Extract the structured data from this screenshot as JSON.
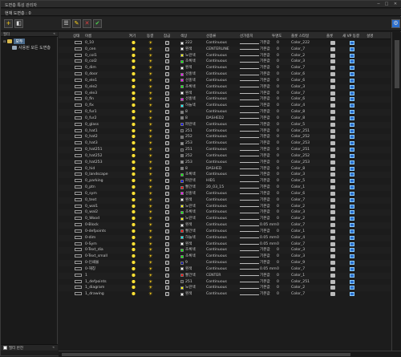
{
  "window": {
    "title": "도면층 특성 관리자",
    "controls": [
      "─",
      "□",
      "✕"
    ]
  },
  "current_layer": {
    "label": "현재 도면층 : 0"
  },
  "toolbar": {
    "new_filter": "+",
    "new_group": "◧",
    "layer_states": "☰",
    "new_layer": "✎",
    "delete_layer": "✕",
    "set_current": "✔",
    "settings": "⚙"
  },
  "left_panel": {
    "header": "필터",
    "collapse": "«",
    "root": "모두",
    "child": "사용된 모든 도면층",
    "invert_filter": "필터 반전",
    "collapse2": "«"
  },
  "columns": [
    "상태",
    "이름",
    "켜기",
    "동결",
    "잠금",
    "색상",
    "선종류",
    "선가중치",
    "투명도",
    "플롯 스타일",
    "플롯",
    "새 VP 동결",
    "설명"
  ],
  "rows": [
    {
      "name": "0_10",
      "color": "#ffffff",
      "color_name": "222",
      "linetype": "Continuous",
      "lw": "기본값",
      "tr": "0",
      "ps": "Color_222"
    },
    {
      "name": "0_cen",
      "color": "#ffffff",
      "color_name": "흰색",
      "linetype": "CENTERLINE",
      "lw": "기본값",
      "tr": "0",
      "ps": "Color_7"
    },
    {
      "name": "0_col1",
      "color": "#ffff00",
      "color_name": "노란색",
      "linetype": "Continuous",
      "lw": "기본값",
      "tr": "0",
      "ps": "Color_2"
    },
    {
      "name": "0_col2",
      "color": "#00ff00",
      "color_name": "초록색",
      "linetype": "Continuous",
      "lw": "기본값",
      "tr": "0",
      "ps": "Color_3"
    },
    {
      "name": "0_dim",
      "color": "#ffffff",
      "color_name": "흰색",
      "linetype": "Continuous",
      "lw": "기본값",
      "tr": "0",
      "ps": "Color_7"
    },
    {
      "name": "0_door",
      "color": "#ff00ff",
      "color_name": "선홍색",
      "linetype": "Continuous",
      "lw": "기본값",
      "tr": "0",
      "ps": "Color_6"
    },
    {
      "name": "0_ele1",
      "color": "#ff00ff",
      "color_name": "선홍색",
      "linetype": "Continuous",
      "lw": "기본값",
      "tr": "0",
      "ps": "Color_6"
    },
    {
      "name": "0_ele2",
      "color": "#00ff00",
      "color_name": "초록색",
      "linetype": "Continuous",
      "lw": "기본값",
      "tr": "0",
      "ps": "Color_3"
    },
    {
      "name": "0_ele3",
      "color": "#ffffff",
      "color_name": "흰색",
      "linetype": "Continuous",
      "lw": "기본값",
      "tr": "0",
      "ps": "Color_7"
    },
    {
      "name": "0_fin",
      "color": "#ff00ff",
      "color_name": "선홍색",
      "linetype": "Continuous",
      "lw": "기본값",
      "tr": "0",
      "ps": "Color_6"
    },
    {
      "name": "0_fix",
      "color": "#00ffff",
      "color_name": "하늘색",
      "linetype": "Continuous",
      "lw": "기본값",
      "tr": "0",
      "ps": "Color_4"
    },
    {
      "name": "0_fur1",
      "color": "#808080",
      "color_name": "8",
      "linetype": "Continuous",
      "lw": "기본값",
      "tr": "0",
      "ps": "Color_8"
    },
    {
      "name": "0_fur2",
      "color": "#808080",
      "color_name": "8",
      "linetype": "DASHED2",
      "lw": "기본값",
      "tr": "0",
      "ps": "Color_8"
    },
    {
      "name": "0_glass",
      "color": "#0000ff",
      "color_name": "파란색",
      "linetype": "Continuous",
      "lw": "기본값",
      "tr": "0",
      "ps": "Color_5"
    },
    {
      "name": "0_hat1",
      "color": "#3c3c3c",
      "color_name": "251",
      "linetype": "Continuous",
      "lw": "기본값",
      "tr": "0",
      "ps": "Color_251"
    },
    {
      "name": "0_hat2",
      "color": "#707070",
      "color_name": "252",
      "linetype": "Continuous",
      "lw": "기본값",
      "tr": "0",
      "ps": "Color_252"
    },
    {
      "name": "0_hat3",
      "color": "#989898",
      "color_name": "253",
      "linetype": "Continuous",
      "lw": "기본값",
      "tr": "0",
      "ps": "Color_253"
    },
    {
      "name": "0_hat251",
      "color": "#3c3c3c",
      "color_name": "251",
      "linetype": "Continuous",
      "lw": "기본값",
      "tr": "0",
      "ps": "Color_251"
    },
    {
      "name": "0_hat252",
      "color": "#707070",
      "color_name": "252",
      "linetype": "Continuous",
      "lw": "기본값",
      "tr": "0",
      "ps": "Color_252"
    },
    {
      "name": "0_hat253",
      "color": "#989898",
      "color_name": "253",
      "linetype": "Continuous",
      "lw": "기본값",
      "tr": "0",
      "ps": "Color_253"
    },
    {
      "name": "0_hid",
      "color": "#808080",
      "color_name": "8",
      "linetype": "DASHED",
      "lw": "기본값",
      "tr": "0",
      "ps": "Color_8"
    },
    {
      "name": "0_landscape",
      "color": "#00ff00",
      "color_name": "초록색",
      "linetype": "Continuous",
      "lw": "기본값",
      "tr": "0",
      "ps": "Color_3"
    },
    {
      "name": "0_parking",
      "color": "#0000ff",
      "color_name": "파란색",
      "linetype": "HID1",
      "lw": "기본값",
      "tr": "0",
      "ps": "Color_5"
    },
    {
      "name": "0_ptn",
      "color": "#ff0000",
      "color_name": "빨간색",
      "linetype": "20_03_15",
      "lw": "기본값",
      "tr": "0",
      "ps": "Color_1"
    },
    {
      "name": "0_sym",
      "color": "#ff00ff",
      "color_name": "선홍색",
      "linetype": "Continuous",
      "lw": "기본값",
      "tr": "0",
      "ps": "Color_6"
    },
    {
      "name": "0_text",
      "color": "#ffffff",
      "color_name": "흰색",
      "linetype": "Continuous",
      "lw": "기본값",
      "tr": "0",
      "ps": "Color_7"
    },
    {
      "name": "0_wal1",
      "color": "#ffff00",
      "color_name": "노란색",
      "linetype": "Continuous",
      "lw": "기본값",
      "tr": "0",
      "ps": "Color_2"
    },
    {
      "name": "0_wal2",
      "color": "#00ff00",
      "color_name": "초록색",
      "linetype": "Continuous",
      "lw": "기본값",
      "tr": "0",
      "ps": "Color_3"
    },
    {
      "name": "0_Wood",
      "color": "#ffff00",
      "color_name": "노란색",
      "linetype": "Continuous",
      "lw": "기본값",
      "tr": "0",
      "ps": "Color_2"
    },
    {
      "name": "0-Block",
      "color": "#ffffff",
      "color_name": "흰색",
      "linetype": "Continuous",
      "lw": "0.05 mm",
      "tr": "0",
      "ps": "Color_7"
    },
    {
      "name": "0-defpoints",
      "color": "#ff0000",
      "color_name": "빨간색",
      "linetype": "Continuous",
      "lw": "기본값",
      "tr": "0",
      "ps": "Color_1"
    },
    {
      "name": "0-dim",
      "color": "#00ffff",
      "color_name": "하늘색",
      "linetype": "Continuous",
      "lw": "0.05 mm",
      "tr": "0",
      "ps": "Color_4"
    },
    {
      "name": "0-Sym",
      "color": "#ffffff",
      "color_name": "흰색",
      "linetype": "Continuous",
      "lw": "0.05 mm",
      "tr": "0",
      "ps": "Color_7"
    },
    {
      "name": "0-Text_dia",
      "color": "#00ff00",
      "color_name": "초록색",
      "linetype": "Continuous",
      "lw": "기본값",
      "tr": "0",
      "ps": "Color_3"
    },
    {
      "name": "0-Text_small",
      "color": "#00ff00",
      "color_name": "초록색",
      "linetype": "Continuous",
      "lw": "기본값",
      "tr": "0",
      "ps": "Color_3"
    },
    {
      "name": "0-인쇄물",
      "color": "#0000a0",
      "color_name": "9",
      "linetype": "Continuous",
      "lw": "기본값",
      "tr": "0",
      "ps": "Color_9"
    },
    {
      "name": "0-해칭",
      "color": "#ffffff",
      "color_name": "흰색",
      "linetype": "Continuous",
      "lw": "0.05 mm",
      "tr": "0",
      "ps": "Color_7"
    },
    {
      "name": "1",
      "color": "#ff0000",
      "color_name": "빨간색",
      "linetype": "CENTER",
      "lw": "기본값",
      "tr": "0",
      "ps": "Color_1"
    },
    {
      "name": "1_defpoints",
      "color": "#3c3c3c",
      "color_name": "251",
      "linetype": "Continuous",
      "lw": "기본값",
      "tr": "0",
      "ps": "Color_251"
    },
    {
      "name": "1_diagram",
      "color": "#ffff00",
      "color_name": "노란색",
      "linetype": "Continuous",
      "lw": "기본값",
      "tr": "0",
      "ps": "Color_2"
    },
    {
      "name": "1_drawing",
      "color": "#ffffff",
      "color_name": "흰색",
      "linetype": "Continuous",
      "lw": "기본값",
      "tr": "0",
      "ps": "Color_7"
    }
  ]
}
